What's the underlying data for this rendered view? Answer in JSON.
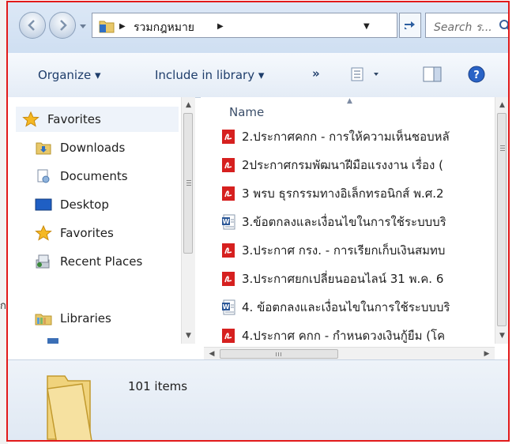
{
  "background": {
    "partial_text": "ก"
  },
  "address_bar": {
    "breadcrumb": "รวมกฎหมาย",
    "search_placeholder": "Search ร..."
  },
  "toolbar": {
    "organize": "Organize ▾",
    "include_in_library": "Include in library ▾",
    "more": "»"
  },
  "nav": {
    "favorites": "Favorites",
    "downloads": "Downloads",
    "documents": "Documents",
    "desktop": "Desktop",
    "favorites2": "Favorites",
    "recent_places": "Recent Places",
    "libraries": "Libraries"
  },
  "file_list": {
    "column_name": "Name",
    "files": [
      {
        "name": "2.ประกาศคกก - การให้ความเห็นชอบหลั",
        "type": "pdf"
      },
      {
        "name": "2ประกาศกรมพัฒนาฝีมือแรงงาน เรื่อง (",
        "type": "pdf"
      },
      {
        "name": "3 พรบ ธุรกรรมทางอิเล็กทรอนิกส์ พ.ศ.2",
        "type": "pdf"
      },
      {
        "name": "3.ข้อตกลงและเงื่อนไขในการใช้ระบบบริ",
        "type": "word"
      },
      {
        "name": "3.ประกาศ กรง. - การเรียกเก็บเงินสมทบ",
        "type": "pdf"
      },
      {
        "name": "3.ประกาศยกเปลี่ยนออนไลน์ 31 พ.ค. 6",
        "type": "pdf"
      },
      {
        "name": "4. ข้อตกลงและเงื่อนไขในการใช้ระบบบริ",
        "type": "word"
      },
      {
        "name": "4.ประกาศ คกก - กำหนดวงเงินกู้ยืม (โค",
        "type": "pdf"
      }
    ]
  },
  "details": {
    "item_count": "101 items"
  },
  "colors": {
    "frame": "#e21a1a",
    "toolbar_text": "#1e3d6b",
    "pdf": "#d6201f",
    "word": "#2b5797"
  }
}
